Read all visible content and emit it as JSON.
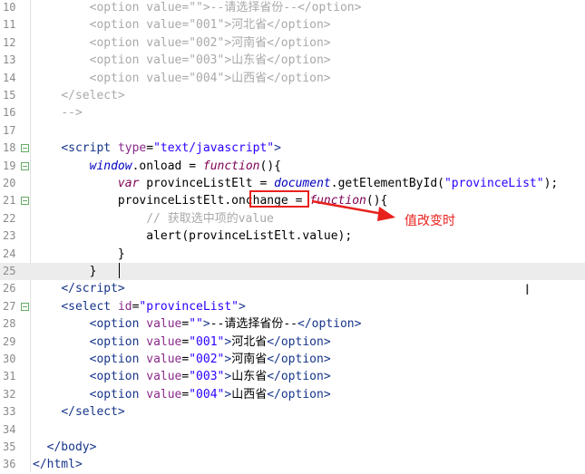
{
  "editor": {
    "lines": [
      {
        "n": "10",
        "html": "        <span class='t-faded'>&lt;option value=\"\"&gt;--请选择省份--&lt;/option&gt;</span>"
      },
      {
        "n": "11",
        "html": "        <span class='t-faded'>&lt;option value=\"001\"&gt;河北省&lt;/option&gt;</span>"
      },
      {
        "n": "12",
        "html": "        <span class='t-faded'>&lt;option value=\"002\"&gt;河南省&lt;/option&gt;</span>"
      },
      {
        "n": "13",
        "html": "        <span class='t-faded'>&lt;option value=\"003\"&gt;山东省&lt;/option&gt;</span>"
      },
      {
        "n": "14",
        "html": "        <span class='t-faded'>&lt;option value=\"004\"&gt;山西省&lt;/option&gt;</span>"
      },
      {
        "n": "15",
        "html": "    <span class='t-faded'>&lt;/select&gt;</span>"
      },
      {
        "n": "16",
        "html": "    <span class='t-faded'>--&gt;</span>"
      },
      {
        "n": "17",
        "html": ""
      },
      {
        "n": "18",
        "html": "    <span class='t-tag'>&lt;script</span> <span class='t-attr'>type</span>=<span class='t-str'>\"text/javascript\"</span><span class='t-tag'>&gt;</span>",
        "fold": true
      },
      {
        "n": "19",
        "html": "        <span class='t-obj'>window</span>.onload = <span class='t-kw'>function</span>(){",
        "fold": true
      },
      {
        "n": "20",
        "html": "            <span class='t-kw'>var</span> provinceListElt = <span class='t-obj'>document</span>.getElementById(<span class='t-str'>\"provinceList\"</span>);"
      },
      {
        "n": "21",
        "html": "            provinceListElt.onchange = <span class='t-kw'>function</span>(){",
        "fold": true
      },
      {
        "n": "22",
        "html": "                <span class='t-faded'>// 获取选中项的value</span>"
      },
      {
        "n": "23",
        "html": "                alert(provinceListElt.value);"
      },
      {
        "n": "24",
        "html": "            }"
      },
      {
        "n": "25",
        "html": "        }",
        "current": true
      },
      {
        "n": "26",
        "html": "    <span class='t-tag'>&lt;/script&gt;</span>"
      },
      {
        "n": "27",
        "html": "    <span class='t-tag'>&lt;select</span> <span class='t-attr'>id</span>=<span class='t-str'>\"provinceList\"</span><span class='t-tag'>&gt;</span>",
        "fold": true
      },
      {
        "n": "28",
        "html": "        <span class='t-tag'>&lt;option</span> <span class='t-attr'>value</span>=<span class='t-str'>\"\"</span><span class='t-tag'>&gt;</span>--请选择省份--<span class='t-tag'>&lt;/option&gt;</span>"
      },
      {
        "n": "29",
        "html": "        <span class='t-tag'>&lt;option</span> <span class='t-attr'>value</span>=<span class='t-str'>\"001\"</span><span class='t-tag'>&gt;</span>河北省<span class='t-tag'>&lt;/option&gt;</span>"
      },
      {
        "n": "30",
        "html": "        <span class='t-tag'>&lt;option</span> <span class='t-attr'>value</span>=<span class='t-str'>\"002\"</span><span class='t-tag'>&gt;</span>河南省<span class='t-tag'>&lt;/option&gt;</span>"
      },
      {
        "n": "31",
        "html": "        <span class='t-tag'>&lt;option</span> <span class='t-attr'>value</span>=<span class='t-str'>\"003\"</span><span class='t-tag'>&gt;</span>山东省<span class='t-tag'>&lt;/option&gt;</span>"
      },
      {
        "n": "32",
        "html": "        <span class='t-tag'>&lt;option</span> <span class='t-attr'>value</span>=<span class='t-str'>\"004\"</span><span class='t-tag'>&gt;</span>山西省<span class='t-tag'>&lt;/option&gt;</span>"
      },
      {
        "n": "33",
        "html": "    <span class='t-tag'>&lt;/select&gt;</span>"
      },
      {
        "n": "34",
        "html": ""
      },
      {
        "n": "35",
        "html": "  <span class='t-tag'>&lt;/body&gt;</span>"
      },
      {
        "n": "36",
        "html": "<span class='t-tag'>&lt;/html&gt;</span>"
      }
    ]
  },
  "annotation": {
    "label": "值改变时",
    "color": "#e8211d"
  }
}
